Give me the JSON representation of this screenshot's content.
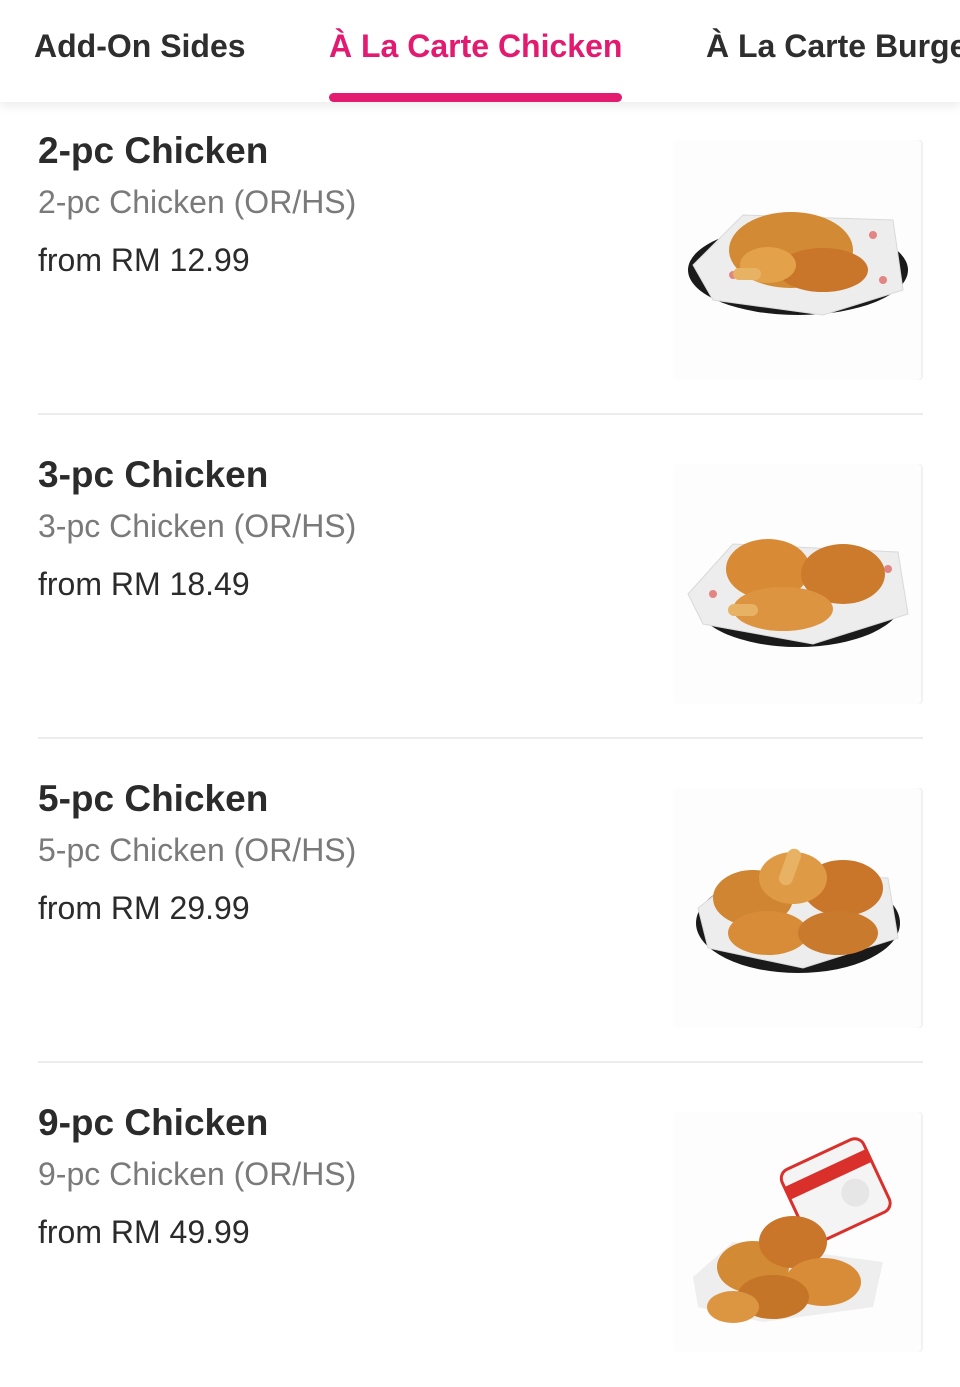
{
  "tabs": [
    {
      "label": "Add-On Sides",
      "active": false
    },
    {
      "label": "À La Carte Chicken",
      "active": true
    },
    {
      "label": "À La Carte Burgers",
      "active": false
    }
  ],
  "colors": {
    "accent": "#e21b70",
    "text": "#2b2b2b",
    "muted": "#7a7a7a",
    "divider": "#ececec"
  },
  "menu_items": [
    {
      "name": "2-pc Chicken",
      "description": "2-pc Chicken (OR/HS)",
      "price": "from RM 12.99",
      "image": "fried-chicken-plate-image"
    },
    {
      "name": "3-pc Chicken",
      "description": "3-pc Chicken (OR/HS)",
      "price": "from RM 18.49",
      "image": "fried-chicken-plate-image"
    },
    {
      "name": "5-pc Chicken",
      "description": "5-pc Chicken (OR/HS)",
      "price": "from RM 29.99",
      "image": "fried-chicken-plate-image"
    },
    {
      "name": "9-pc Chicken",
      "description": "9-pc Chicken (OR/HS)",
      "price": "from RM 49.99",
      "image": "chicken-bucket-image"
    }
  ]
}
